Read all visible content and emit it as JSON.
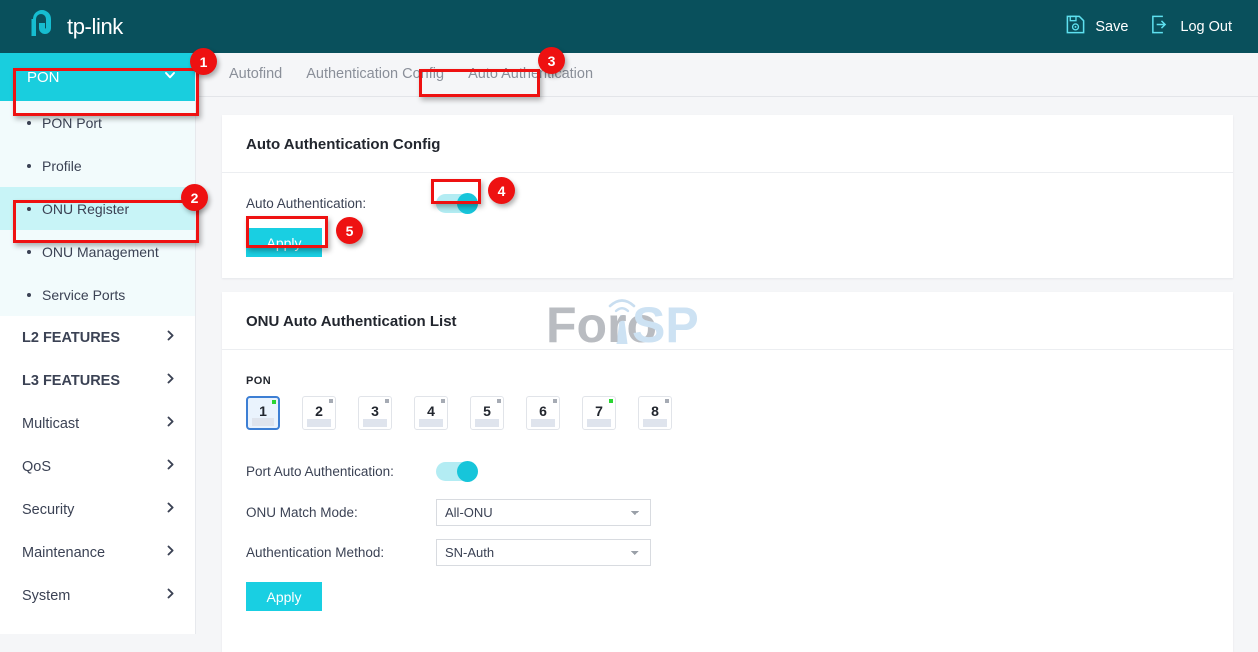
{
  "header": {
    "brand": "tp-link",
    "brand_icon": "tp-link-logo-icon",
    "actions": [
      {
        "label": "Save",
        "icon": "save-disk-gear-icon"
      },
      {
        "label": "Log Out",
        "icon": "logout-arrow-icon"
      }
    ]
  },
  "sidebar": {
    "section": {
      "label": "PON",
      "icon": "chevron-down-icon",
      "expanded": true
    },
    "sub_items": [
      {
        "label": "PON Port",
        "active": false
      },
      {
        "label": "Profile",
        "active": false
      },
      {
        "label": "ONU Register",
        "active": true
      },
      {
        "label": "ONU Management",
        "active": false
      },
      {
        "label": "Service Ports",
        "active": false
      }
    ],
    "nav_items": [
      {
        "label": "L2 FEATURES",
        "bold": true,
        "icon": "chevron-right-icon"
      },
      {
        "label": "L3 FEATURES",
        "bold": true,
        "icon": "chevron-right-icon"
      },
      {
        "label": "Multicast",
        "bold": false,
        "icon": "chevron-right-icon"
      },
      {
        "label": "QoS",
        "bold": false,
        "icon": "chevron-right-icon"
      },
      {
        "label": "Security",
        "bold": false,
        "icon": "chevron-right-icon"
      },
      {
        "label": "Maintenance",
        "bold": false,
        "icon": "chevron-right-icon"
      },
      {
        "label": "System",
        "bold": false,
        "icon": "chevron-right-icon"
      }
    ]
  },
  "tabs": [
    {
      "label": "Autofind",
      "active": false
    },
    {
      "label": "Authentication Config",
      "active": false
    },
    {
      "label": "Auto Authentication",
      "active": true
    }
  ],
  "config_panel": {
    "title": "Auto Authentication Config",
    "auto_auth_label": "Auto Authentication:",
    "auto_auth_enabled": true,
    "apply_label": "Apply"
  },
  "list_panel": {
    "title": "ONU Auto Authentication List",
    "pon_label": "PON",
    "ports": [
      {
        "number": "1",
        "status": "on",
        "selected": true
      },
      {
        "number": "2",
        "status": "off",
        "selected": false
      },
      {
        "number": "3",
        "status": "off",
        "selected": false
      },
      {
        "number": "4",
        "status": "off",
        "selected": false
      },
      {
        "number": "5",
        "status": "off",
        "selected": false
      },
      {
        "number": "6",
        "status": "off",
        "selected": false
      },
      {
        "number": "7",
        "status": "on",
        "selected": false
      },
      {
        "number": "8",
        "status": "off",
        "selected": false
      }
    ],
    "port_auto_auth_label": "Port Auto Authentication:",
    "port_auto_auth_enabled": true,
    "match_mode_label": "ONU Match Mode:",
    "match_mode_value": "All-ONU",
    "match_mode_options": [
      "All-ONU"
    ],
    "auth_method_label": "Authentication Method:",
    "auth_method_value": "SN-Auth",
    "auth_method_options": [
      "SN-Auth"
    ],
    "apply_label": "Apply"
  },
  "watermark": {
    "text_gray": "Foro",
    "text_blue": "ISP"
  },
  "annotations": [
    {
      "number": "1"
    },
    {
      "number": "2"
    },
    {
      "number": "3"
    },
    {
      "number": "4"
    },
    {
      "number": "5"
    }
  ],
  "colors": {
    "header_bg": "#09505c",
    "accent_cyan": "#19cfe2",
    "active_submenu": "#c8f4f7",
    "annotation_red": "#ee1111",
    "port_selected_border": "#3d7fd4",
    "status_green": "#2ad532"
  }
}
